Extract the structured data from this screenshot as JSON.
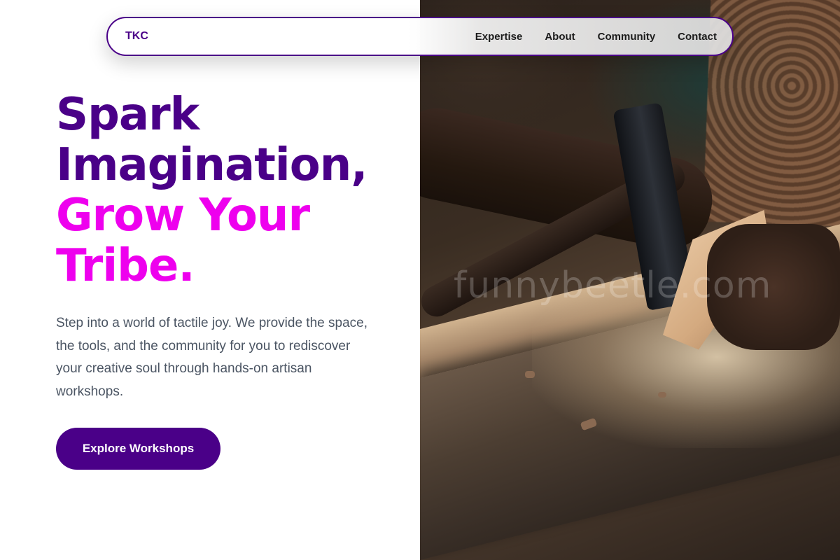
{
  "nav": {
    "brand": "TKC",
    "links": [
      "Expertise",
      "About",
      "Community",
      "Contact"
    ]
  },
  "hero": {
    "headline_line1": "Spark",
    "headline_line2": "Imagination,",
    "headline_line3": "Grow Your",
    "headline_line4": "Tribe.",
    "lead": "Step into a world of tactile joy. We provide the space, the tools, and the community for you to rediscover your creative soul through hands-on artisan workshops.",
    "cta_label": "Explore Workshops"
  },
  "image": {
    "watermark": "funnybeetle.com"
  },
  "colors": {
    "primary": "#4a0088",
    "accent": "#ee00ee",
    "body_text": "#4b5563"
  }
}
